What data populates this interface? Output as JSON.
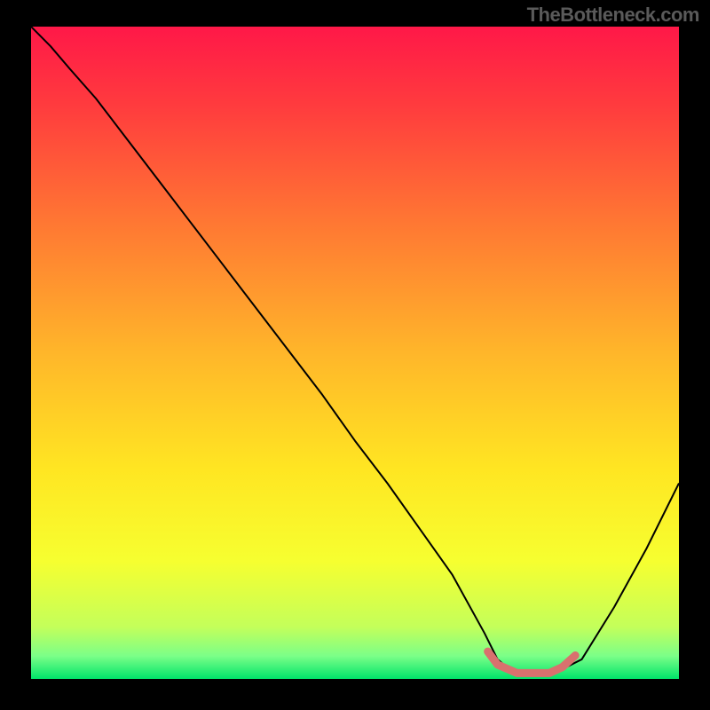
{
  "watermark": "TheBottleneck.com",
  "chart_data": {
    "type": "line",
    "title": "",
    "xlabel": "",
    "ylabel": "",
    "xlim": [
      0,
      100
    ],
    "ylim": [
      0,
      100
    ],
    "background_gradient": {
      "type": "vertical",
      "stops": [
        {
          "offset": 0.0,
          "color": "#ff1848"
        },
        {
          "offset": 0.12,
          "color": "#ff3b3e"
        },
        {
          "offset": 0.3,
          "color": "#ff7733"
        },
        {
          "offset": 0.5,
          "color": "#ffb62a"
        },
        {
          "offset": 0.68,
          "color": "#ffe622"
        },
        {
          "offset": 0.82,
          "color": "#f6ff30"
        },
        {
          "offset": 0.92,
          "color": "#c4ff5a"
        },
        {
          "offset": 0.965,
          "color": "#7bff88"
        },
        {
          "offset": 1.0,
          "color": "#00e46a"
        }
      ]
    },
    "series": [
      {
        "name": "bottleneck-curve",
        "color": "#000000",
        "stroke_width": 2,
        "x": [
          0,
          3,
          6,
          10,
          15,
          20,
          25,
          30,
          35,
          40,
          45,
          50,
          55,
          60,
          65,
          70,
          72,
          75,
          80,
          85,
          90,
          95,
          100
        ],
        "y": [
          100,
          97,
          93.5,
          89,
          82.5,
          76,
          69.5,
          63,
          56.5,
          50,
          43.5,
          36.5,
          30,
          23,
          16,
          7,
          3,
          0.5,
          0.5,
          3,
          11,
          20,
          30
        ]
      },
      {
        "name": "optimal-range",
        "color": "#d9716e",
        "stroke_width": 9,
        "linecap": "round",
        "x": [
          70.5,
          72,
          75,
          78,
          80,
          82,
          84
        ],
        "y": [
          4.2,
          2.2,
          0.9,
          0.9,
          0.9,
          1.8,
          3.6
        ]
      }
    ]
  }
}
